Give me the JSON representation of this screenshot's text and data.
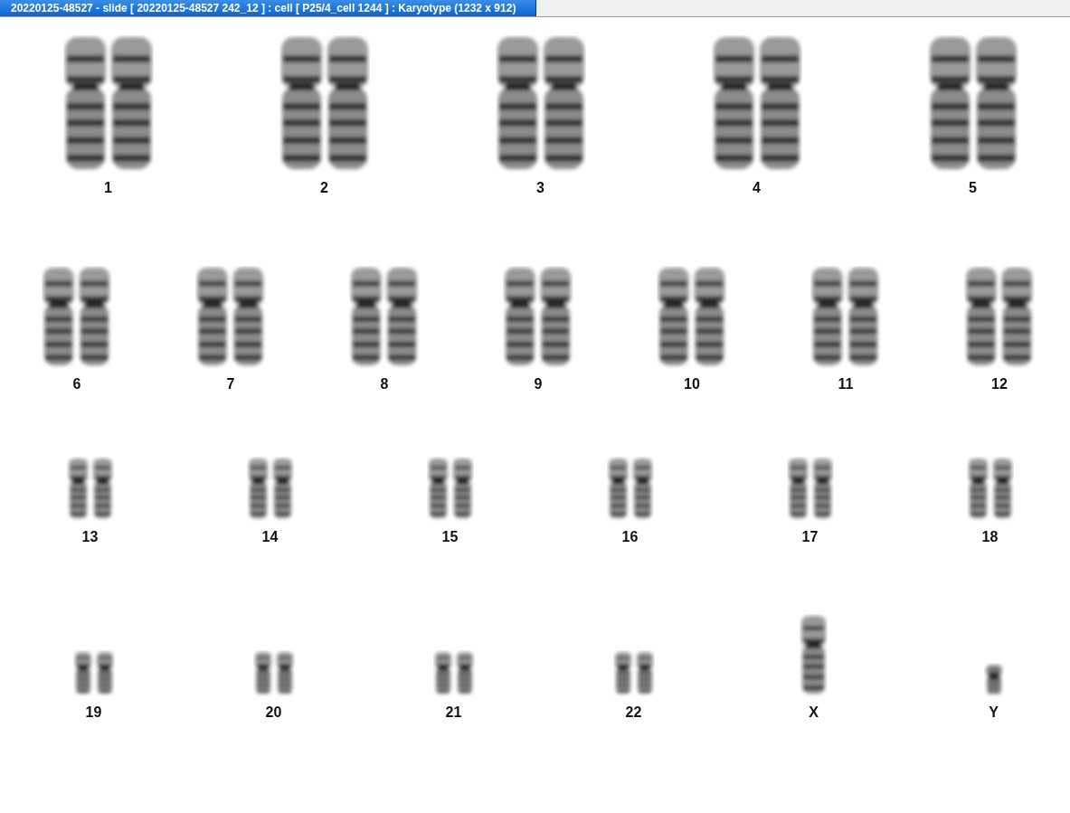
{
  "window": {
    "title": "20220125-48527 - slide [ 20220125-48527 242_12 ] : cell [ P25/4_cell 1244 ] : Karyotype  (1232 x 912)"
  },
  "rows": [
    [
      {
        "label": "1",
        "kind": "pair"
      },
      {
        "label": "2",
        "kind": "pair"
      },
      {
        "label": "3",
        "kind": "pair"
      },
      {
        "label": "4",
        "kind": "pair"
      },
      {
        "label": "5",
        "kind": "pair"
      }
    ],
    [
      {
        "label": "6",
        "kind": "pair"
      },
      {
        "label": "7",
        "kind": "pair"
      },
      {
        "label": "8",
        "kind": "pair"
      },
      {
        "label": "9",
        "kind": "pair"
      },
      {
        "label": "10",
        "kind": "pair"
      },
      {
        "label": "11",
        "kind": "pair"
      },
      {
        "label": "12",
        "kind": "pair"
      }
    ],
    [
      {
        "label": "13",
        "kind": "pair"
      },
      {
        "label": "14",
        "kind": "pair"
      },
      {
        "label": "15",
        "kind": "pair"
      },
      {
        "label": "16",
        "kind": "pair"
      },
      {
        "label": "17",
        "kind": "pair"
      },
      {
        "label": "18",
        "kind": "pair"
      }
    ],
    [
      {
        "label": "19",
        "kind": "pair"
      },
      {
        "label": "20",
        "kind": "pair"
      },
      {
        "label": "21",
        "kind": "pair"
      },
      {
        "label": "22",
        "kind": "pair"
      },
      {
        "label": "X",
        "kind": "single"
      },
      {
        "label": "Y",
        "kind": "single"
      }
    ]
  ]
}
